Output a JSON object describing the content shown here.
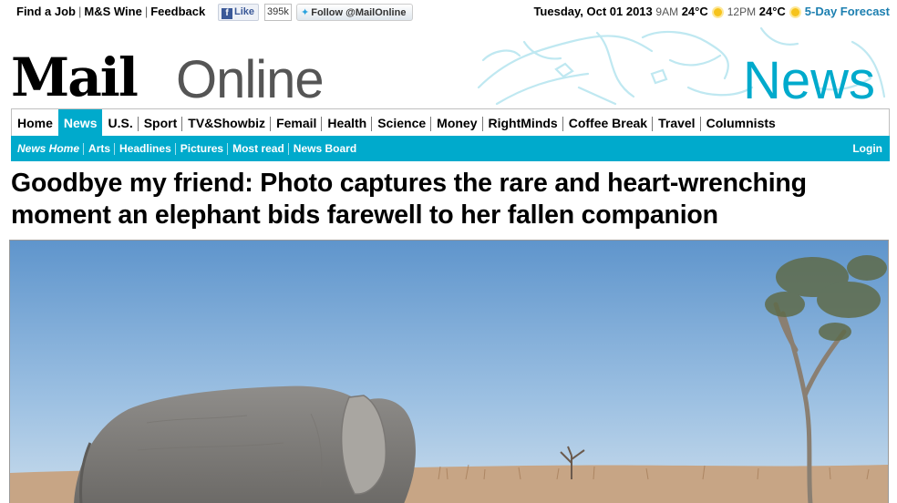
{
  "topbar": {
    "links": [
      "Find a Job",
      "M&S Wine",
      "Feedback"
    ],
    "facebook": {
      "label": "Like",
      "count": "395k"
    },
    "twitter": {
      "label": "Follow @MailOnline"
    },
    "date": "Tuesday, Oct 01 2013",
    "weather": [
      {
        "time": "9AM",
        "temp": "24°C",
        "icon": "sun-icon"
      },
      {
        "time": "12PM",
        "temp": "24°C",
        "icon": "sun-icon"
      }
    ],
    "forecast_link": "5-Day Forecast"
  },
  "masthead": {
    "logo_mail": "Mail",
    "logo_online": "Online",
    "section": "News"
  },
  "nav": {
    "items": [
      "Home",
      "News",
      "U.S.",
      "Sport",
      "TV&Showbiz",
      "Femail",
      "Health",
      "Science",
      "Money",
      "RightMinds",
      "Coffee Break",
      "Travel",
      "Columnists"
    ],
    "active": "News"
  },
  "subnav": {
    "items": [
      "News Home",
      "Arts",
      "Headlines",
      "Pictures",
      "Most read",
      "News Board"
    ],
    "login": "Login"
  },
  "article": {
    "headline": "Goodbye my friend: Photo captures the rare and heart-wrenching moment an elephant bids farewell to her fallen companion",
    "photo_alt": "elephant-photo"
  },
  "colors": {
    "accent": "#00aacc",
    "weather_link": "#1c7fb0",
    "sky": "#8fb7dc"
  }
}
